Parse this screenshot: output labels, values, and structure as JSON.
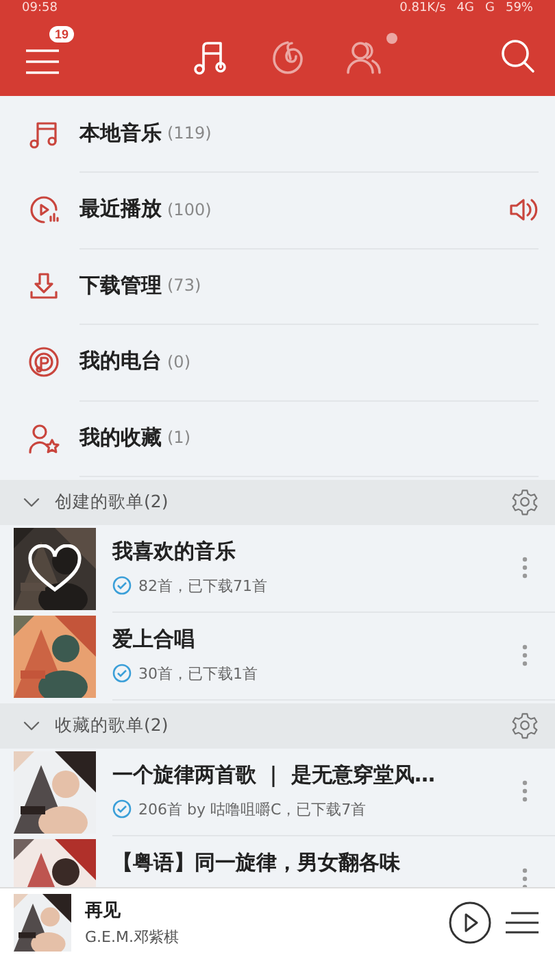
{
  "status_bar": {
    "time": "09:58",
    "speed": "0.81K/s",
    "network_1": "4G",
    "network_2": "G",
    "battery": "59%"
  },
  "nav": {
    "badge": "19",
    "tabs": [
      {
        "kind": "music",
        "selected": true,
        "dot": false
      },
      {
        "kind": "disc",
        "selected": false,
        "dot": false
      },
      {
        "kind": "friends",
        "selected": false,
        "dot": true
      }
    ]
  },
  "menu": [
    {
      "kind": "local",
      "label": "本地音乐",
      "count": "(119)",
      "playing": false
    },
    {
      "kind": "recent",
      "label": "最近播放",
      "count": "(100)",
      "playing": true
    },
    {
      "kind": "download",
      "label": "下载管理",
      "count": "(73)",
      "playing": false
    },
    {
      "kind": "radio",
      "label": "我的电台",
      "count": "(0)",
      "playing": false
    },
    {
      "kind": "favorite",
      "label": "我的收藏",
      "count": "(1)",
      "playing": false
    }
  ],
  "sections": [
    {
      "title": "创建的歌单(2)",
      "expanded": true,
      "playlists": [
        {
          "title": "我喜欢的音乐",
          "info": "82首，已下载71首",
          "downloaded": true,
          "liked": true
        },
        {
          "title": "爱上合唱",
          "info": "30首，已下载1首",
          "downloaded": true,
          "liked": false
        }
      ]
    },
    {
      "title": "收藏的歌单(2)",
      "expanded": true,
      "playlists": [
        {
          "title": "一个旋律两首歌 ｜ 是无意穿堂风…",
          "info": "206首 by 咕噜咀嚼C，已下载7首",
          "downloaded": true,
          "liked": false
        },
        {
          "title": "【粤语】同一旋律，男女翻各味",
          "liked": false
        }
      ]
    }
  ],
  "player": {
    "title": "再见",
    "artist": "G.E.M.邓紫棋"
  }
}
